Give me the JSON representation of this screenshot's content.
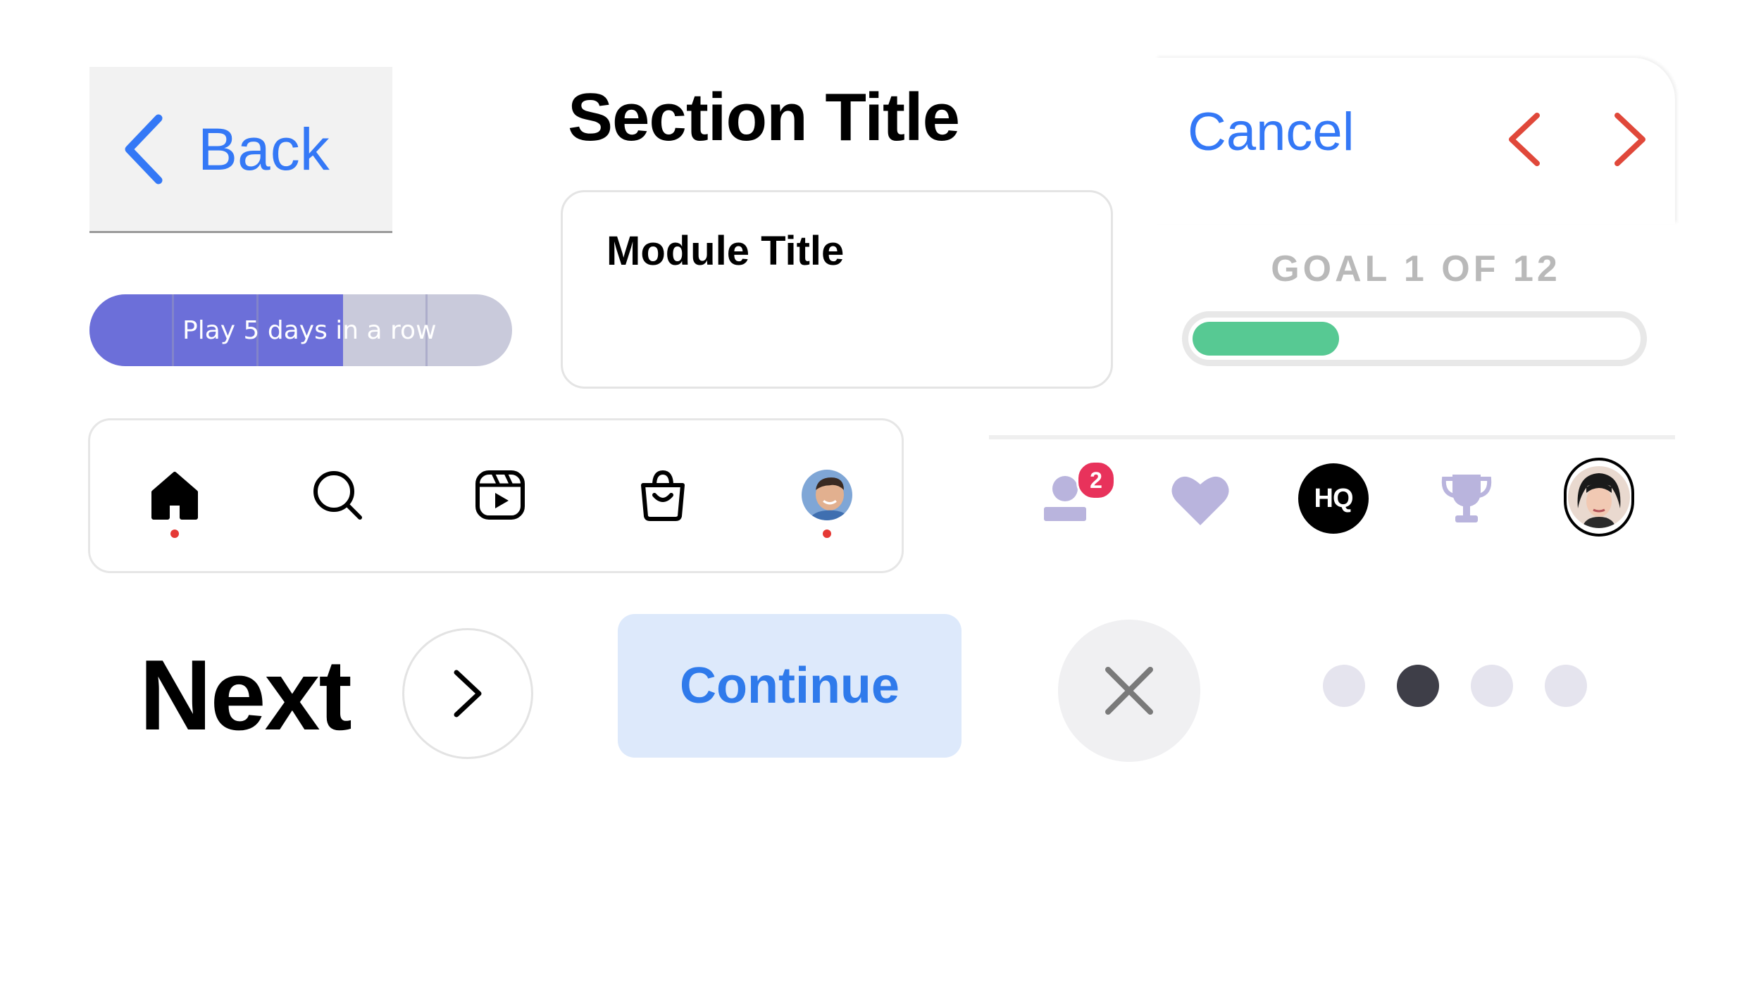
{
  "back": {
    "label": "Back"
  },
  "section": {
    "title": "Section Title"
  },
  "module": {
    "title": "Module Title"
  },
  "top_nav": {
    "cancel_label": "Cancel",
    "chevron_color": "#e0483a"
  },
  "streak": {
    "label": "Play 5 days in a row",
    "segments": 4,
    "progress_fraction": 0.6,
    "fill_color": "#6c6fd9",
    "track_color": "#c9cadb"
  },
  "goal": {
    "label": "GOAL 1 OF 12",
    "progress_fraction": 0.33,
    "fill_color": "#57c993"
  },
  "tabbar_a": {
    "items": [
      {
        "name": "home",
        "icon": "home-icon",
        "active_dot": true
      },
      {
        "name": "search",
        "icon": "search-icon",
        "active_dot": false
      },
      {
        "name": "reels",
        "icon": "reels-icon",
        "active_dot": false
      },
      {
        "name": "shop",
        "icon": "shopping-bag-icon",
        "active_dot": false
      },
      {
        "name": "profile",
        "icon": "profile-avatar",
        "active_dot": true
      }
    ],
    "dot_color": "#e53935"
  },
  "tabbar_b": {
    "items": [
      {
        "name": "friends",
        "icon": "friends-icon",
        "badge": "2"
      },
      {
        "name": "likes",
        "icon": "heart-icon"
      },
      {
        "name": "home",
        "icon": "hq-logo",
        "label": "HQ"
      },
      {
        "name": "leaderboard",
        "icon": "trophy-icon"
      },
      {
        "name": "profile",
        "icon": "profile-avatar"
      }
    ],
    "icon_color": "#b9b4dd",
    "badge_color": "#e8325b"
  },
  "next": {
    "label": "Next"
  },
  "continue": {
    "label": "Continue",
    "bg_color": "#dde9fb",
    "text_color": "#2f7aeb"
  },
  "close": {
    "icon": "close-icon"
  },
  "page_indicator": {
    "count": 4,
    "active_index": 1,
    "active_color": "#3e3e48",
    "inactive_color": "#e5e4ee"
  }
}
